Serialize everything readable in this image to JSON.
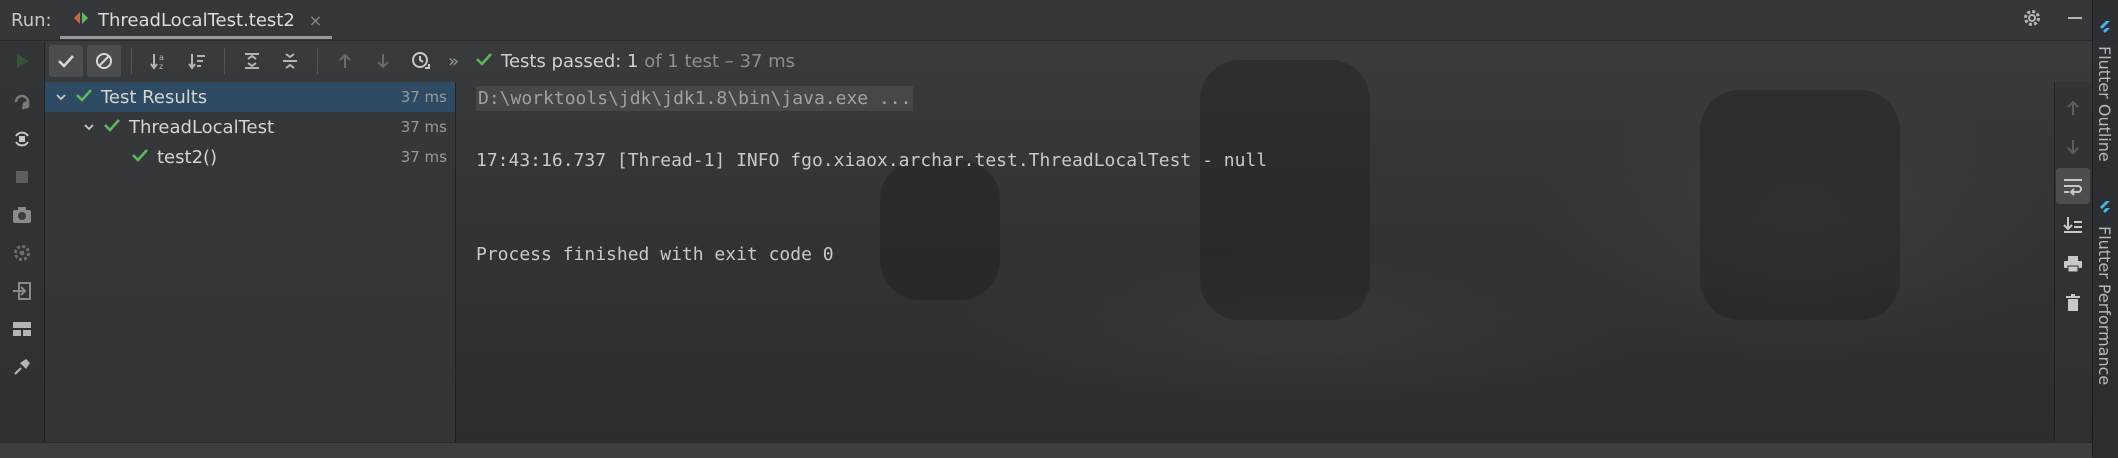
{
  "header": {
    "run_label": "Run:",
    "tab_title": "ThreadLocalTest.test2",
    "close_glyph": "×"
  },
  "toolbar": {
    "more_glyph": "»",
    "status_main": "Tests passed: 1",
    "status_rest": " of 1 test – 37 ms"
  },
  "tree": {
    "rows": [
      {
        "label": "Test Results",
        "duration": "37 ms"
      },
      {
        "label": "ThreadLocalTest",
        "duration": "37 ms"
      },
      {
        "label": "test2()",
        "duration": "37 ms"
      }
    ]
  },
  "console": {
    "command": "D:\\worktools\\jdk\\jdk1.8\\bin\\java.exe ...",
    "log_line": "17:43:16.737 [Thread-1] INFO fgo.xiaox.archar.test.ThreadLocalTest - null",
    "exit_line": "Process finished with exit code 0"
  },
  "side": {
    "tab1": "Flutter Outline",
    "tab2": "Flutter Performance"
  },
  "colors": {
    "pass_green": "#5fb85f",
    "run_green": "#49a84a",
    "flutter_blue": "#47b3e8",
    "selection": "#2f4a63"
  },
  "icons": {
    "header": [
      "gear-icon",
      "minimize-icon"
    ],
    "toolbar": [
      "run-icon",
      "show-passed-icon",
      "show-ignored-icon",
      "sort-alphabetically-icon",
      "sort-by-duration-icon",
      "expand-all-icon",
      "collapse-all-icon",
      "previous-failed-icon",
      "next-failed-icon",
      "test-history-icon"
    ],
    "gutter": [
      "rerun-failed-icon",
      "toggle-auto-test-icon",
      "stop-icon",
      "screenshot-icon",
      "settings-icon",
      "exit-icon",
      "layout-icon",
      "pin-icon"
    ],
    "console_tools": [
      "up-arrow-icon",
      "down-arrow-icon",
      "soft-wrap-icon",
      "scroll-to-end-icon",
      "print-icon",
      "trash-icon"
    ]
  }
}
